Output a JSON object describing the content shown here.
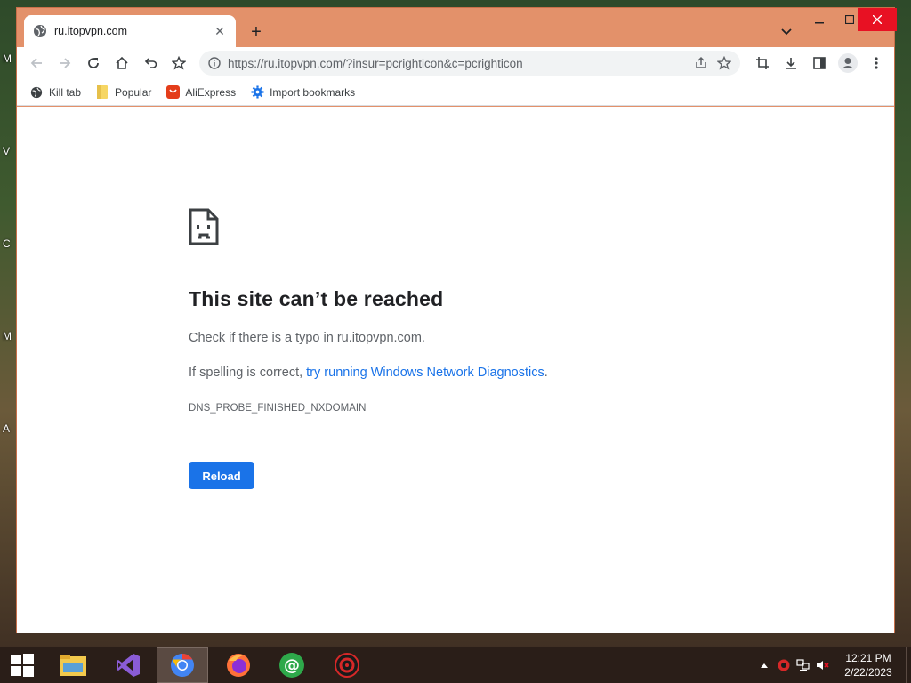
{
  "desktop": {
    "edge_letters": [
      "M",
      "V",
      "C",
      "M",
      "A"
    ]
  },
  "browser": {
    "tab": {
      "title": "ru.itopvpn.com"
    },
    "newtab_label": "+",
    "omnibox": {
      "url": "https://ru.itopvpn.com/?insur=pcrighticon&c=pcrighticon"
    },
    "bookmarks": [
      {
        "label": "Kill tab",
        "icon": "globe-icon"
      },
      {
        "label": "Popular",
        "icon": "folder-icon"
      },
      {
        "label": "AliExpress",
        "icon": "aliexpress-icon"
      },
      {
        "label": "Import bookmarks",
        "icon": "gear-icon"
      }
    ]
  },
  "error_page": {
    "title": "This site can’t be reached",
    "line1": "Check if there is a typo in ru.itopvpn.com.",
    "line2_prefix": "If spelling is correct, ",
    "line2_link": "try running Windows Network Diagnostics",
    "line2_suffix": ".",
    "error_code": "DNS_PROBE_FINISHED_NXDOMAIN",
    "reload_label": "Reload"
  },
  "taskbar": {
    "apps": [
      "start-icon",
      "file-explorer-icon",
      "visual-studio-icon",
      "chrome-icon",
      "firefox-icon",
      "mail-at-icon",
      "antivirus-icon"
    ],
    "active_app": "chrome-icon",
    "clock": {
      "time": "12:21 PM",
      "date": "2/22/2023"
    }
  },
  "colors": {
    "accent": "#1a73e8",
    "frame": "#e3916a",
    "close": "#e81123"
  }
}
